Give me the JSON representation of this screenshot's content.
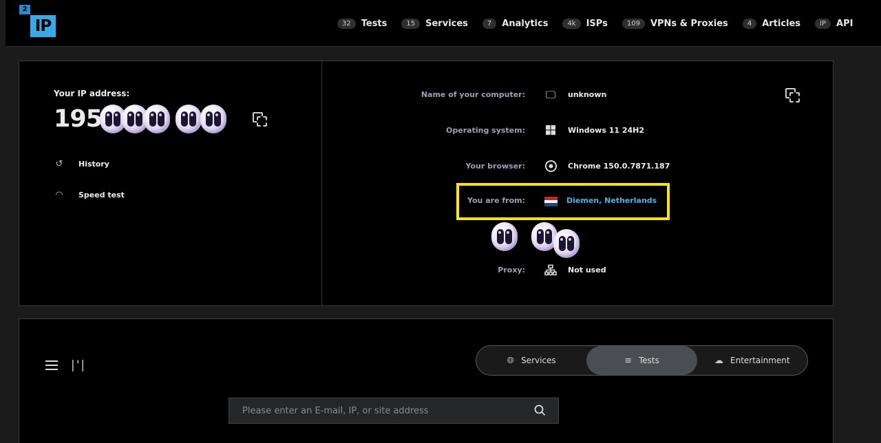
{
  "logo": {
    "small": "2",
    "big": "IP"
  },
  "nav": [
    {
      "count": "32",
      "label": "Tests"
    },
    {
      "count": "15",
      "label": "Services"
    },
    {
      "count": "7",
      "label": "Analytics"
    },
    {
      "count": "4k",
      "label": "ISPs"
    },
    {
      "count": "109",
      "label": "VPNs & Proxies"
    },
    {
      "count": "4",
      "label": "Articles"
    },
    {
      "count": "IP",
      "label": "API"
    }
  ],
  "ip": {
    "label": "Your IP address:",
    "prefix": "195."
  },
  "side_links": {
    "history": "History",
    "speed": "Speed test"
  },
  "info": {
    "computer_label": "Name of your computer:",
    "computer_value": "unknown",
    "os_label": "Operating system:",
    "os_value": "Windows 11 24H2",
    "browser_label": "Your browser:",
    "browser_value": "Chrome 150.0.7871.187",
    "location_label": "You are from:",
    "location_value": "Diemen, Netherlands",
    "proxy_label": "Proxy:",
    "proxy_value": "Not used"
  },
  "colors": {
    "accent": "#3aa7e6",
    "highlight": "#ffe600",
    "link": "#4fb3ea"
  },
  "tabs": [
    {
      "label": "Services",
      "icon": "globe-icon"
    },
    {
      "label": "Tests",
      "icon": "sliders-icon"
    },
    {
      "label": "Entertainment",
      "icon": "cloud-icon"
    }
  ],
  "search": {
    "placeholder": "Please enter an E-mail, IP, or site address"
  }
}
